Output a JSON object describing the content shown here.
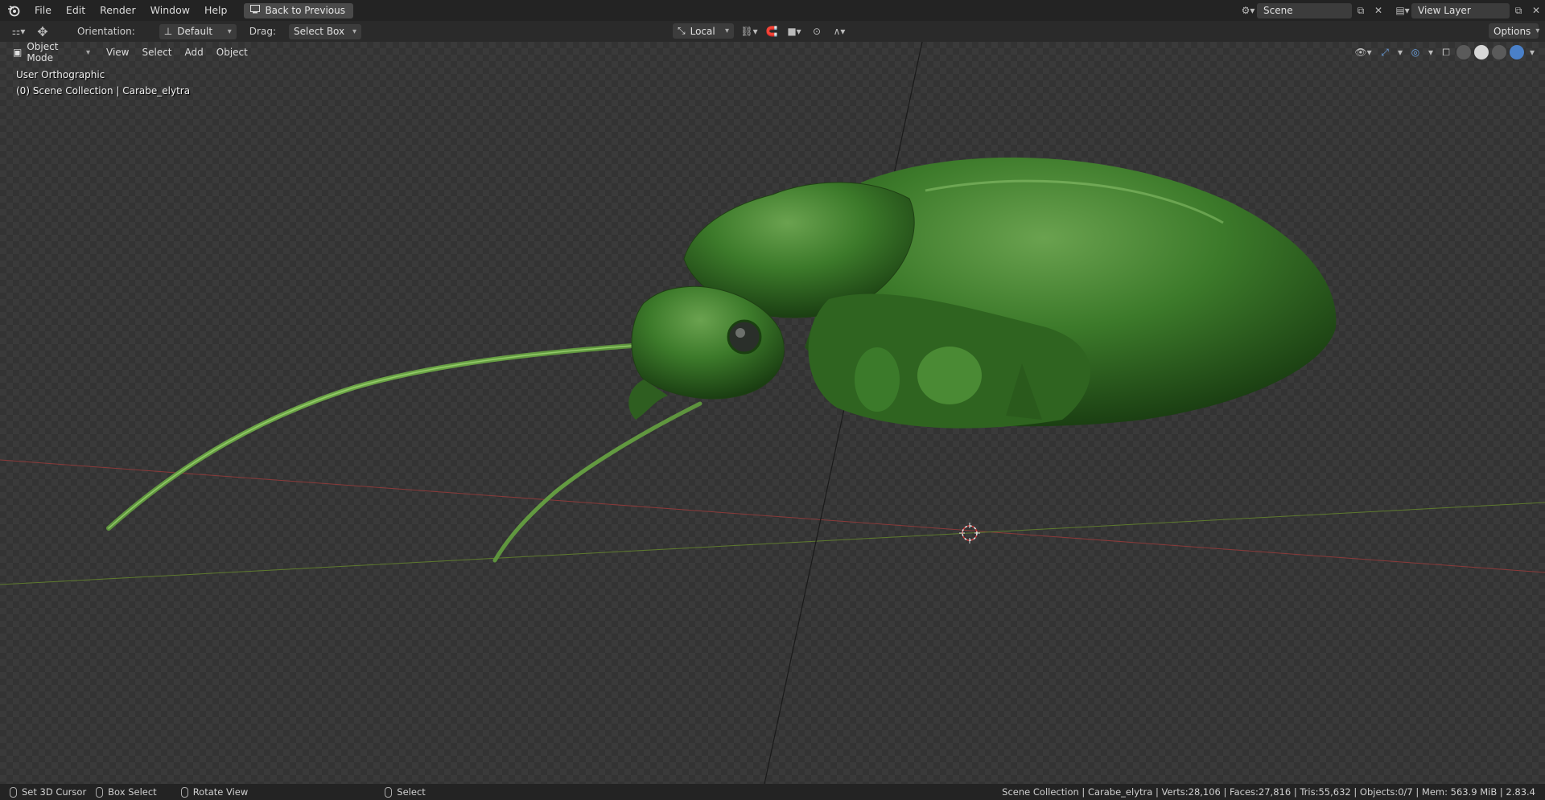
{
  "menubar": {
    "items": [
      "File",
      "Edit",
      "Render",
      "Window",
      "Help"
    ],
    "back_button": "Back to Previous",
    "scene": "Scene",
    "view_layer": "View Layer"
  },
  "toolheader": {
    "orientation_label": "Orientation:",
    "orientation_value": "Default",
    "drag_label": "Drag:",
    "drag_value": "Select Box",
    "pivot_value": "Local",
    "options_label": "Options"
  },
  "viewport": {
    "mode": "Object Mode",
    "menu": [
      "View",
      "Select",
      "Add",
      "Object"
    ],
    "view_name": "User Orthographic",
    "collection_info": "(0) Scene Collection | Carabe_elytra"
  },
  "statusbar": {
    "left": [
      "Set 3D Cursor",
      "Box Select",
      "Rotate View",
      "Select"
    ],
    "right": "Scene Collection | Carabe_elytra | Verts:28,106 | Faces:27,816 | Tris:55,632 | Objects:0/7 | Mem: 563.9 MiB | 2.83.4"
  },
  "colors": {
    "beetle": "#3f7a2c",
    "x_axis": "#8a3a3a",
    "y_axis": "#5e7a2e"
  }
}
